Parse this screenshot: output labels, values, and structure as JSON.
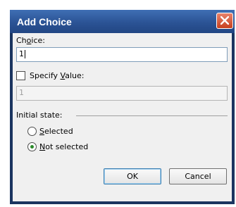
{
  "dialog": {
    "title": "Add Choice",
    "choice_label_prefix": "Ch",
    "choice_label_mnemonic": "o",
    "choice_label_suffix": "ice:",
    "choice_value": "1",
    "specify_prefix": "Specify ",
    "specify_mnemonic": "V",
    "specify_suffix": "alue:",
    "value_field_value": "1",
    "initial_state_label": "Initial state:",
    "selected_mnemonic": "S",
    "selected_rest": "elected",
    "not_selected_mnemonic": "N",
    "not_selected_rest": "ot selected",
    "ok_label": "OK",
    "cancel_label": "Cancel"
  },
  "state": {
    "specify_value_checked": false,
    "initial_state": "Not selected"
  },
  "colors": {
    "titlebar": "#2b5395",
    "close_button": "#c7401f",
    "radio_dot": "#2b8a2b"
  },
  "icons": {
    "close": "close-icon"
  }
}
